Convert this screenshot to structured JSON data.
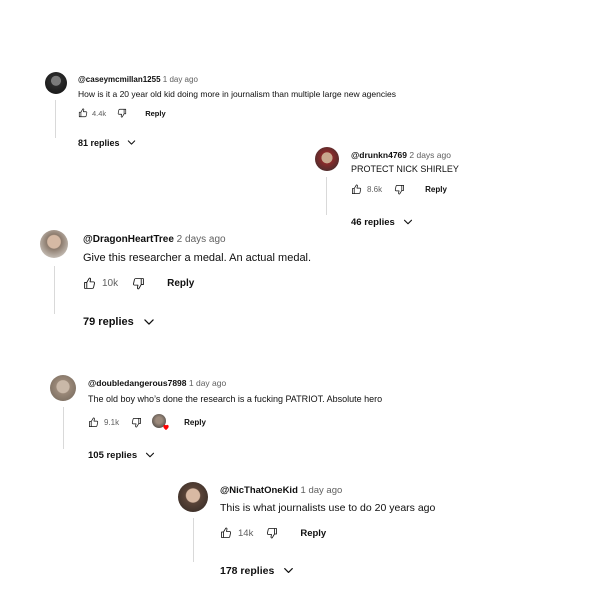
{
  "comments": [
    {
      "handle": "@caseymcmillan1255",
      "time": "1 day ago",
      "text": "How is it a 20 year old kid doing more in journalism than multiple large new agencies",
      "likes": "4.4k",
      "reply_label": "Reply",
      "replies": "81 replies"
    },
    {
      "handle": "@drunkn4769",
      "time": "2 days ago",
      "text": "PROTECT NICK SHIRLEY",
      "likes": "8.6k",
      "reply_label": "Reply",
      "replies": "46 replies"
    },
    {
      "handle": "@DragonHeartTree",
      "time": "2 days ago",
      "text": "Give this researcher a medal. An actual medal.",
      "likes": "10k",
      "reply_label": "Reply",
      "replies": "79 replies"
    },
    {
      "handle": "@doubledangerous7898",
      "time": "1 day ago",
      "text": "The old boy who’s done the research is a fucking PATRIOT. Absolute hero",
      "likes": "9.1k",
      "reply_label": "Reply",
      "replies": "105 replies"
    },
    {
      "handle": "@NicThatOneKid",
      "time": "1 day ago",
      "text": "This is what journalists use to do 20 years ago",
      "likes": "14k",
      "reply_label": "Reply",
      "replies": "178 replies"
    }
  ],
  "icons": {
    "like": "thumbs-up-icon",
    "dislike": "thumbs-down-icon",
    "expand": "chevron-down-icon",
    "creator_heart": "heart-icon"
  },
  "colors": {
    "heart": "#ff0000",
    "muted": "#606060",
    "line": "#d9d9d9"
  }
}
